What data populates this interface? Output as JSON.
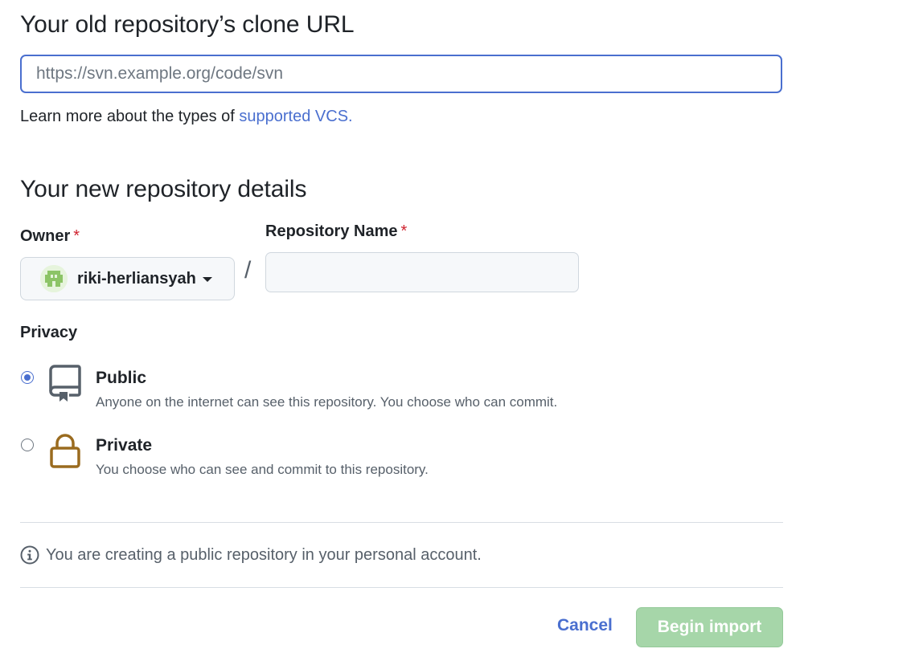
{
  "old_repo": {
    "title": "Your old repository’s clone URL",
    "url_placeholder": "https://svn.example.org/code/svn",
    "url_value": "",
    "learn_prefix": "Learn more about the types of ",
    "learn_link": "supported VCS."
  },
  "new_repo": {
    "title": "Your new repository details",
    "owner_label": "Owner",
    "required_mark": "*",
    "owner_value": "riki-herliansyah",
    "slash": "/",
    "repo_name_label": "Repository Name",
    "repo_name_value": ""
  },
  "privacy": {
    "label": "Privacy",
    "selected": "public",
    "options": [
      {
        "id": "public",
        "title": "Public",
        "description": "Anyone on the internet can see this repository. You choose who can commit.",
        "icon": "repo-icon"
      },
      {
        "id": "private",
        "title": "Private",
        "description": "You choose who can see and commit to this repository.",
        "icon": "lock-icon"
      }
    ]
  },
  "notice": {
    "text": "You are creating a public repository in your personal account.",
    "icon": "info-icon"
  },
  "actions": {
    "cancel_label": "Cancel",
    "begin_label": "Begin import",
    "begin_enabled": false
  },
  "colors": {
    "accent": "#4a6fcf",
    "required": "#cf222e",
    "primary_disabled": "#a6d6a9",
    "lock": "#9a6b1f"
  }
}
